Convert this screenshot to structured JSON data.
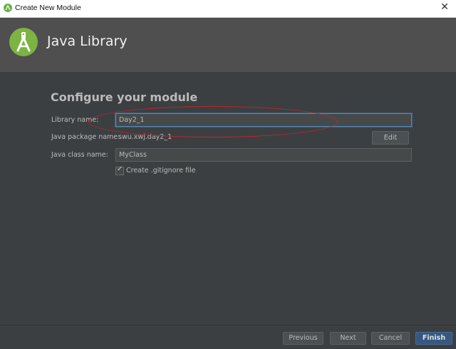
{
  "window": {
    "title": "Create New Module",
    "close_glyph": "✕"
  },
  "header": {
    "title": "Java Library",
    "logo_icon": "android-studio-icon"
  },
  "form": {
    "section_title": "Configure your module",
    "library_name_label": "Library name:",
    "library_name_value": "Day2_1",
    "package_label": "Java package name:",
    "package_value": "swu.xwj.day2_1",
    "edit_button": "Edit",
    "class_label": "Java class name:",
    "class_value": "MyClass",
    "gitignore_label": "Create .gitignore file",
    "gitignore_checked": true
  },
  "footer": {
    "previous": "Previous",
    "next": "Next",
    "cancel": "Cancel",
    "finish": "Finish"
  },
  "colors": {
    "background": "#3c3f41",
    "header": "#4f4f4f",
    "annotation": "#b8282c",
    "accent": "#365880"
  }
}
